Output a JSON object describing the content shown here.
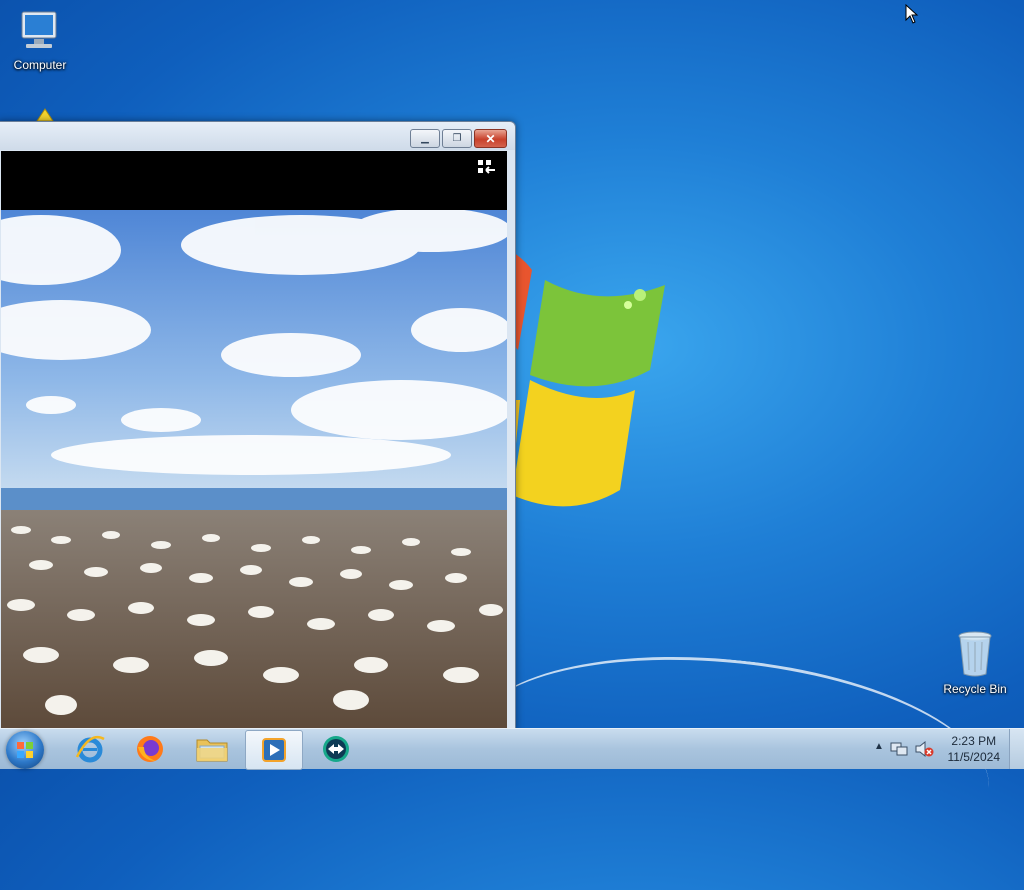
{
  "desktop": {
    "icons": {
      "computer": "Computer",
      "recycle_bin": "Recycle Bin"
    }
  },
  "window": {
    "content": "photo-slideshow-gannet-colony",
    "buttons": [
      "minimize",
      "restore",
      "close"
    ]
  },
  "taskbar": {
    "start": "start-orb",
    "pinned": [
      "internet-explorer",
      "firefox",
      "file-explorer",
      "media-player",
      "teamviewer"
    ],
    "active": "media-player"
  },
  "tray": {
    "time": "2:23 PM",
    "date": "11/5/2024",
    "icons": [
      "show-hidden-icons",
      "network-icon",
      "volume-muted-icon"
    ]
  }
}
